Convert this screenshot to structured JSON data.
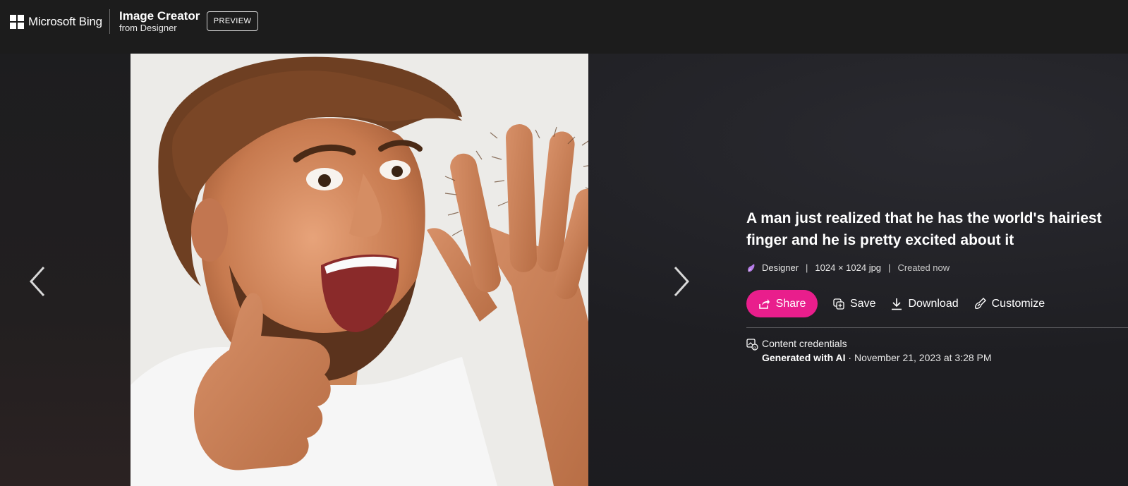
{
  "header": {
    "brand": "Microsoft Bing",
    "app_title": "Image Creator",
    "app_subtitle": "from Designer",
    "preview_label": "PREVIEW"
  },
  "image": {
    "alt": "A man just realized that he has the world's hairiest finger and he is pretty excited about it"
  },
  "detail": {
    "caption": "A man just realized that he has the world's hairiest finger and he is pretty excited about it",
    "source": "Designer",
    "separator": "|",
    "dimensions": "1024 × 1024 jpg",
    "created": "Created now"
  },
  "actions": {
    "share": "Share",
    "save": "Save",
    "download": "Download",
    "customize": "Customize"
  },
  "credentials": {
    "title": "Content credentials",
    "generated": "Generated with AI",
    "dot": " · ",
    "date": "November 21, 2023 at 3:28 PM"
  },
  "colors": {
    "accent": "#e91e8c",
    "background": "#1b1b1b"
  },
  "icons": [
    "microsoft-logo-icon",
    "chevron-left-icon",
    "chevron-right-icon",
    "designer-icon",
    "share-icon",
    "save-icon",
    "download-icon",
    "customize-icon",
    "content-credentials-icon"
  ]
}
